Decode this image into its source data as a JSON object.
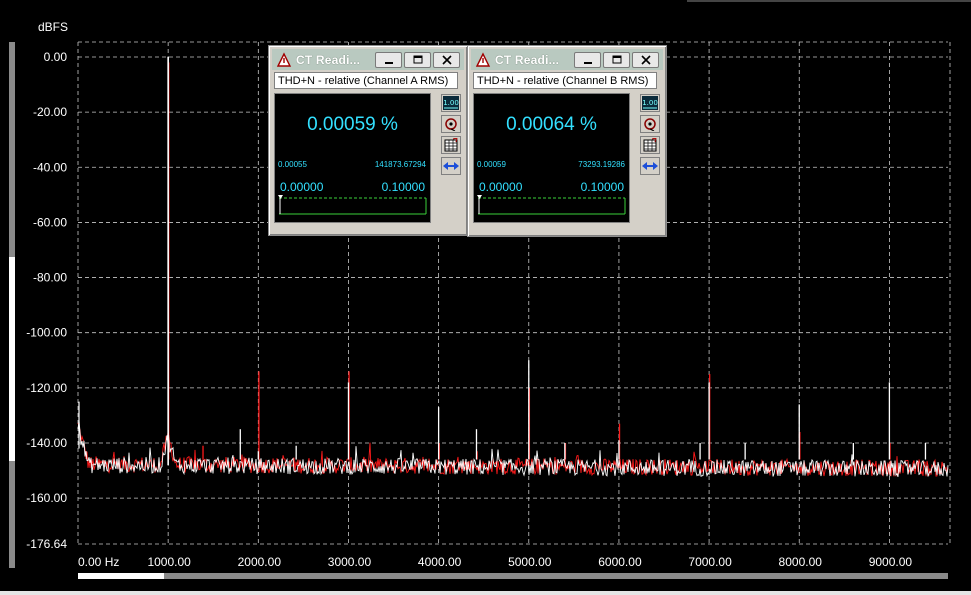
{
  "chart_data": {
    "type": "line",
    "ylabel": "dBFS",
    "ylim": [
      -176.64,
      0.0
    ],
    "xlim": [
      0,
      9650
    ],
    "ytick_values": [
      0,
      -20,
      -40,
      -60,
      -80,
      -100,
      -120,
      -140,
      -160,
      -176.64
    ],
    "ytick_labels": [
      "0.00",
      "-20.00",
      "-40.00",
      "-60.00",
      "-80.00",
      "-100.00",
      "-120.00",
      "-140.00",
      "-160.00",
      "-176.64"
    ],
    "xtick_values": [
      0,
      1000,
      2000,
      3000,
      4000,
      5000,
      6000,
      7000,
      8000,
      9000
    ],
    "xtick_labels": [
      "0.00 Hz",
      "1000.00",
      "2000.00",
      "3000.00",
      "4000.00",
      "5000.00",
      "6000.00",
      "7000.00",
      "8000.00",
      "9000.00"
    ],
    "grid": true,
    "noise_floor_db": -148,
    "series": [
      {
        "color": "#ffffff",
        "peaks": [
          {
            "x": 1000,
            "y": 0.0
          },
          {
            "x": 2000,
            "y": -143
          },
          {
            "x": 3000,
            "y": -118
          },
          {
            "x": 4000,
            "y": -127
          },
          {
            "x": 5000,
            "y": -110
          },
          {
            "x": 6000,
            "y": -139
          },
          {
            "x": 7000,
            "y": -118
          },
          {
            "x": 8000,
            "y": -126
          },
          {
            "x": 9000,
            "y": -118
          },
          {
            "x": 1800,
            "y": -135
          },
          {
            "x": 2420,
            "y": -141
          },
          {
            "x": 4420,
            "y": -135
          },
          {
            "x": 5400,
            "y": -140
          },
          {
            "x": 6900,
            "y": -140
          },
          {
            "x": 7400,
            "y": -140
          },
          {
            "x": 8600,
            "y": -140
          },
          {
            "x": 9400,
            "y": -140
          }
        ]
      },
      {
        "color": "#ff1a1a",
        "peaks": [
          {
            "x": 1000,
            "y": -2
          },
          {
            "x": 2000,
            "y": -114
          },
          {
            "x": 3000,
            "y": -114
          },
          {
            "x": 4000,
            "y": -140
          },
          {
            "x": 5000,
            "y": -120
          },
          {
            "x": 6000,
            "y": -133
          },
          {
            "x": 7000,
            "y": -115
          },
          {
            "x": 8000,
            "y": -136
          },
          {
            "x": 9000,
            "y": -140
          },
          {
            "x": 1380,
            "y": -141
          },
          {
            "x": 5400,
            "y": -140
          },
          {
            "x": 4420,
            "y": -143
          }
        ]
      }
    ]
  },
  "panels": [
    {
      "title": "CT Readi...",
      "measurement": "THD+N - relative (Channel A RMS)",
      "reading": "0.00059 %",
      "small_min": "0.00055",
      "small_max": "141873.67294",
      "bar_min": "0.00000",
      "bar_max": "0.10000",
      "side_label": "1.00"
    },
    {
      "title": "CT Readi...",
      "measurement": "THD+N - relative (Channel B RMS)",
      "reading": "0.00064 %",
      "small_min": "0.00059",
      "small_max": "73293.19286",
      "bar_min": "0.00000",
      "bar_max": "0.10000",
      "side_label": "1.00"
    }
  ],
  "colors": {
    "grid": "#c8c8c8",
    "axis_text": "#ffffff",
    "reading": "#33e0ff",
    "scrollbar": "#8a8a8a",
    "scroll_thumb": "#ffffff"
  },
  "icons": {
    "panel_app": "triangle-meter-icon",
    "minimize": "minimize-icon",
    "maximize": "maximize-icon",
    "close": "close-icon",
    "meter_scale": "meter-scale-icon",
    "probe": "probe-icon",
    "table": "table-icon",
    "stretch": "stretch-arrows-icon"
  }
}
